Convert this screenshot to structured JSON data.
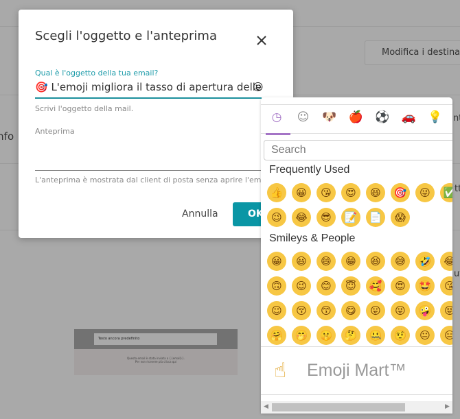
{
  "background": {
    "edit_recipients_button": "Modifica i destinat",
    "partial_text_left": "info",
    "partial_text_right_1": "nt",
    "partial_text_right_2": "tt",
    "partial_text_right_3": "ut",
    "thumbnail": {
      "header": "Testo ancora predefinito",
      "footer_line1": "Questa email è stata inviata a {{email}}.",
      "footer_line2": "Per non ricevere più clicca qui"
    }
  },
  "modal": {
    "title": "Scegli l'oggetto e l'anteprima",
    "subject_label": "Qual è l'oggetto della tua email?",
    "subject_value": "🎯 L'emoji migliora il tasso di apertura delle e",
    "subject_emoji_button": "☺",
    "subject_helper": "Scrivi l'oggetto della mail.",
    "preview_label": "Anteprima",
    "preview_value": "",
    "preview_helper": "L'anteprima è mostrata dal client di posta senza aprire l'email.",
    "cancel_label": "Annulla",
    "ok_label": "OK",
    "accent_color": "#0a96a5"
  },
  "emoji_picker": {
    "tabs": [
      {
        "name": "recent",
        "glyph": "◷",
        "active": true
      },
      {
        "name": "smileys",
        "glyph": "☺"
      },
      {
        "name": "animals",
        "glyph": "🐶"
      },
      {
        "name": "food",
        "glyph": "🍎"
      },
      {
        "name": "activity",
        "glyph": "⚽"
      },
      {
        "name": "travel",
        "glyph": "🚗"
      },
      {
        "name": "objects",
        "glyph": "💡"
      }
    ],
    "active_color": "#a474c6",
    "search_placeholder": "Search",
    "categories": [
      {
        "label": "Frequently Used",
        "emojis": [
          "👍",
          "😀",
          "😘",
          "😍",
          "😆",
          "🎯",
          "😜",
          "✅",
          "😉",
          "😂",
          "😎",
          "📝",
          "📄",
          "😱"
        ]
      },
      {
        "label": "Smileys & People",
        "emojis": [
          "😀",
          "😃",
          "😄",
          "😁",
          "😆",
          "😅",
          "🤣",
          "😂",
          "🙃",
          "😉",
          "😊",
          "😇",
          "🥰",
          "😍",
          "🤩",
          "😘",
          "☺",
          "😚",
          "😙",
          "😋",
          "😛",
          "😜",
          "🤪",
          "😝",
          "🤗",
          "🤭",
          "🤫",
          "🤔",
          "🤐",
          "🤨",
          "😐",
          "😑"
        ]
      }
    ],
    "footer_emoji": "☝",
    "footer_title": "Emoji Mart™"
  }
}
